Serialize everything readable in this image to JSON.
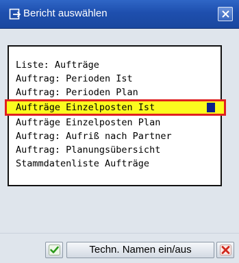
{
  "window": {
    "title": "Bericht auswählen",
    "title_icon": "report-select-icon",
    "close_icon": "close-icon"
  },
  "list": {
    "items": [
      "Liste: Aufträge",
      "Auftrag: Perioden Ist",
      "Auftrag: Perioden Plan",
      "Aufträge Einzelposten Ist",
      "Aufträge Einzelposten Plan",
      "Auftrag: Aufriß nach Partner",
      "Auftrag: Planungsübersicht",
      "Stammdatenliste Aufträge"
    ],
    "selected_index": 3
  },
  "footer": {
    "ok_icon": "checkmark-icon",
    "tech_names_label": "Techn. Namen ein/aus",
    "cancel_icon": "cancel-x-icon"
  },
  "colors": {
    "titlebar": "#1e4fae",
    "selection_highlight": "#fbfb1e",
    "selection_border": "#e02020",
    "ok_green": "#2a9a1a",
    "cancel_red": "#d0281c"
  }
}
